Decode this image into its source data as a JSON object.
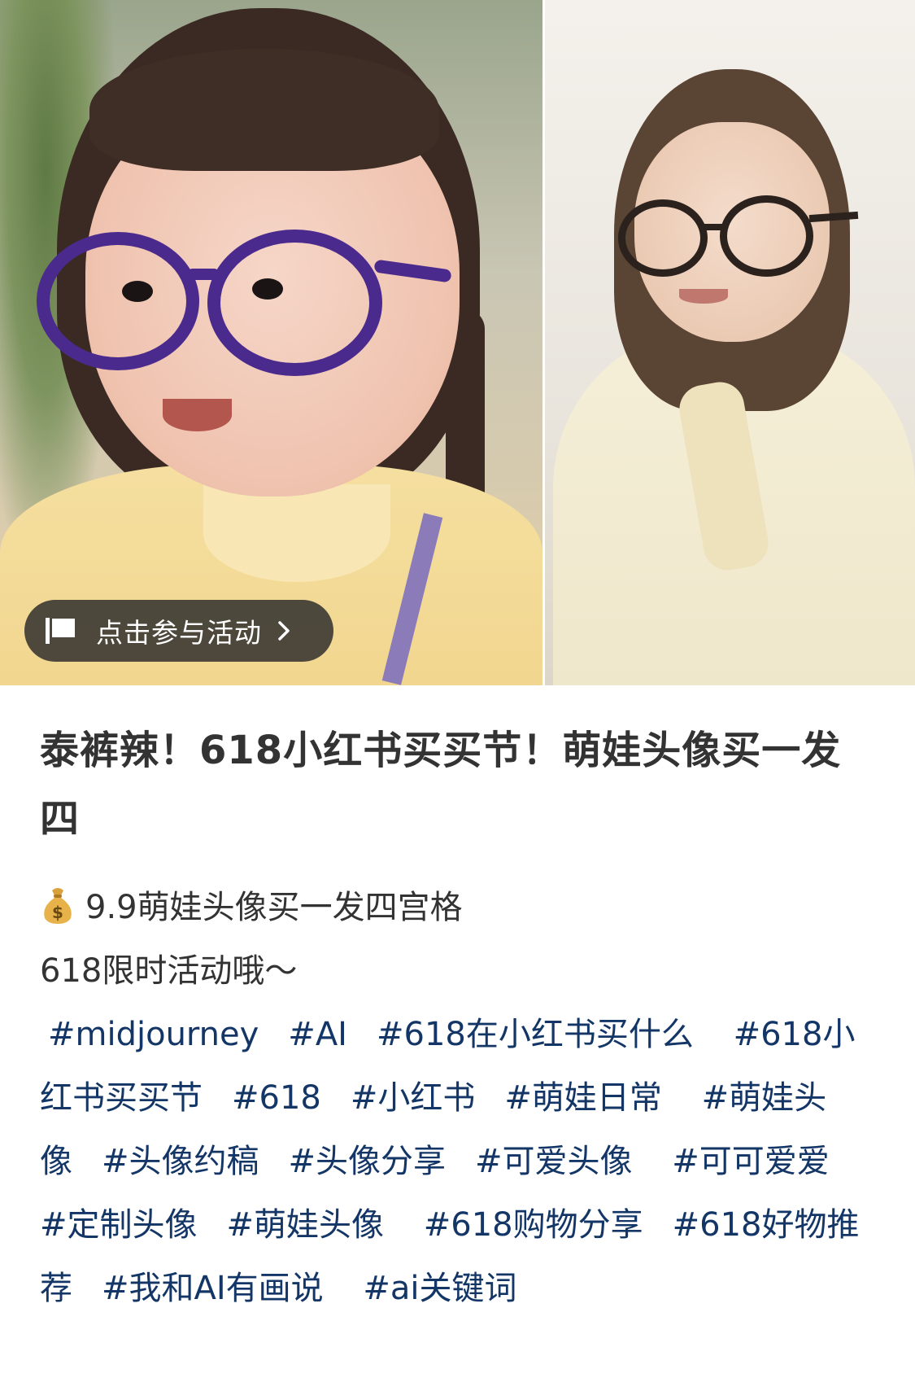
{
  "activity_badge": {
    "label": "点击参与活动"
  },
  "post": {
    "title": "泰裤辣！618小红书买买节！萌娃头像买一发四",
    "lines": [
      "9.9萌娃头像买一发四宫格",
      "618限时活动哦～"
    ],
    "tags": [
      "#midjourney",
      "#AI",
      "#618在小红书买什么",
      "#618小红书买买节",
      "#618",
      "#小红书",
      "#萌娃日常",
      "#萌娃头像",
      "#头像约稿",
      "#头像分享",
      "#可爱头像",
      "#可可爱爱",
      "#定制头像",
      "#萌娃头像",
      "#618购物分享",
      "#618好物推荐",
      "#我和AI有画说",
      "#ai关键词"
    ]
  },
  "icons": {
    "badge": "flag-icon",
    "badge_arrow": "chevron-right-icon",
    "price": "money-bag-icon"
  },
  "colors": {
    "tag_link": "#133667",
    "text": "#333333",
    "badge_bg": "#282828"
  }
}
